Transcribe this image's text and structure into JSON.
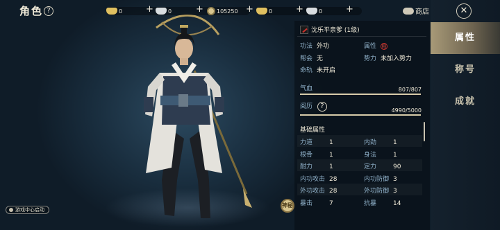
{
  "header": {
    "title": "角色",
    "help": "?"
  },
  "currencies": [
    {
      "icon": "gold-ingot-icon",
      "value": "0",
      "color": "#e0c060"
    },
    {
      "icon": "silver-ingot-icon",
      "value": "0",
      "color": "#d8dde0"
    },
    {
      "icon": "copper-coin-icon",
      "value": "105250",
      "color": "#d8c690"
    },
    {
      "icon": "gold-ingot-icon",
      "value": "0",
      "color": "#e0c060"
    },
    {
      "icon": "silver-ingot-icon",
      "value": "0",
      "color": "#d8dde0"
    }
  ],
  "shop": {
    "label": "商店",
    "icon": "cloud-icon"
  },
  "character": {
    "name_title": "沈乐平亲爹 (1级)",
    "gongfa_label": "功法",
    "gongfa_value": "外功",
    "attr_label": "属性",
    "attr_icon_text": "阳",
    "bang_label": "帮会",
    "bang_value": "无",
    "shili_label": "势力",
    "shili_value": "未加入势力",
    "minggui_label": "命轨",
    "minggui_value": "未开启"
  },
  "gauges": {
    "qixue": {
      "label": "气血",
      "value": "807/807",
      "fraction": 1.0
    },
    "yueli": {
      "label": "阅历",
      "help": "?",
      "value": "4990/5000",
      "fraction": 0.998
    }
  },
  "basic_attrs": {
    "title": "基础属性",
    "rows": [
      {
        "l1": "力道",
        "v1": "1",
        "l2": "内劲",
        "v2": "1"
      },
      {
        "l1": "根骨",
        "v1": "1",
        "l2": "身法",
        "v2": "1"
      },
      {
        "l1": "耐力",
        "v1": "1",
        "l2": "定力",
        "v2": "90"
      },
      {
        "l1": "内功攻击",
        "v1": "28",
        "l2": "内功防御",
        "v2": "3"
      },
      {
        "l1": "外功攻击",
        "v1": "28",
        "l2": "外功防御",
        "v2": "3"
      },
      {
        "l1": "暴击",
        "v1": "7",
        "l2": "抗暴",
        "v2": "14"
      }
    ]
  },
  "tabs": [
    {
      "label": "属性",
      "active": true
    },
    {
      "label": "称号",
      "active": false
    },
    {
      "label": "成就",
      "active": false
    }
  ],
  "close": {
    "label": "✕"
  },
  "bottom_badge": {
    "label": "游戏中心启动"
  },
  "seal": {
    "label": "神秘"
  },
  "colors": {
    "accent": "#d8ccaa",
    "attr_red": "#c8302c",
    "label_blue": "#8fb0c8"
  }
}
